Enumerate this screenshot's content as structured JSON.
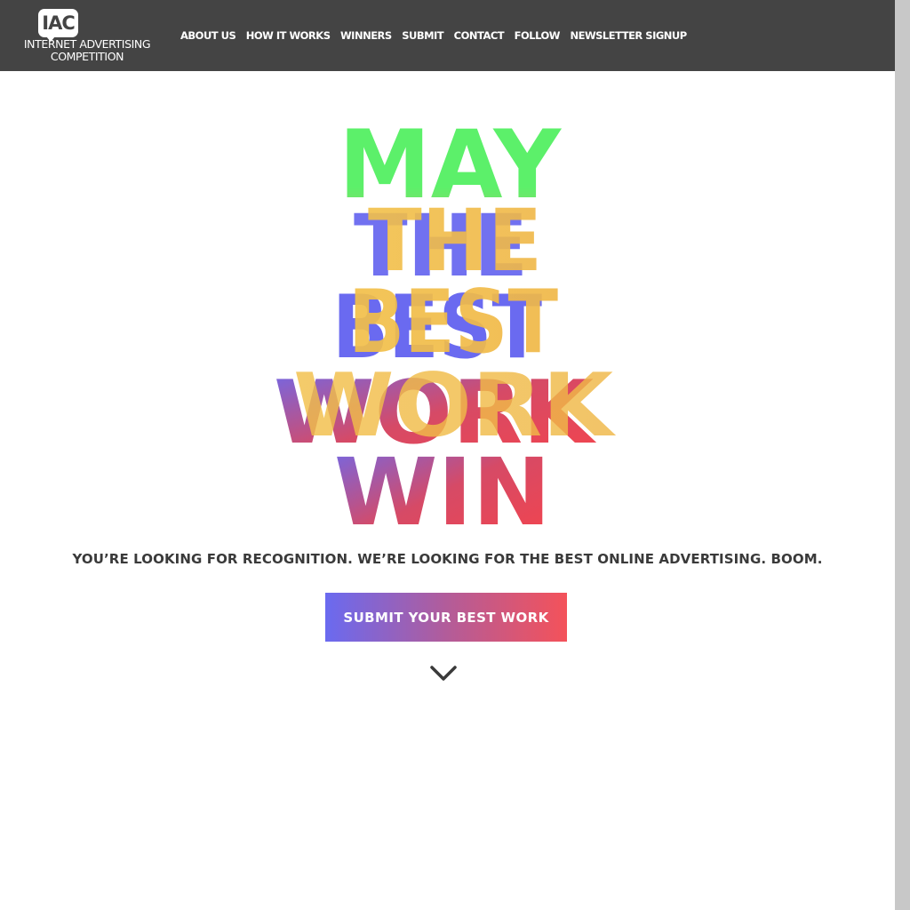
{
  "logo": {
    "mark": "IAC",
    "line1": "INTERNET ADVERTISING",
    "line2": "COMPETITION"
  },
  "nav": {
    "items": [
      {
        "label": "ABOUT US"
      },
      {
        "label": "HOW IT WORKS"
      },
      {
        "label": "WINNERS"
      },
      {
        "label": "SUBMIT"
      },
      {
        "label": "CONTACT"
      },
      {
        "label": "FOLLOW"
      },
      {
        "label": "NEWSLETTER SIGNUP"
      }
    ]
  },
  "hero": {
    "lines": [
      "MAY",
      "THE",
      "BEST",
      "WORK",
      "WIN"
    ],
    "colors": {
      "green": "#5cf06a",
      "blue": "#6a6af0",
      "yellow": "#f2c04a",
      "red": "#f4444c"
    }
  },
  "tagline": "YOU’RE LOOKING FOR RECOGNITION. WE’RE LOOKING FOR THE BEST ONLINE ADVERTISING. BOOM.",
  "cta": {
    "label": "SUBMIT YOUR BEST WORK"
  },
  "icons": {
    "scroll": "chevron-down-icon"
  },
  "colors": {
    "header_bg": "#444444",
    "text": "#3a3a3a",
    "cta_start": "#6a6af0",
    "cta_end": "#f4525a",
    "scrollbar": "#c8c8c8"
  }
}
